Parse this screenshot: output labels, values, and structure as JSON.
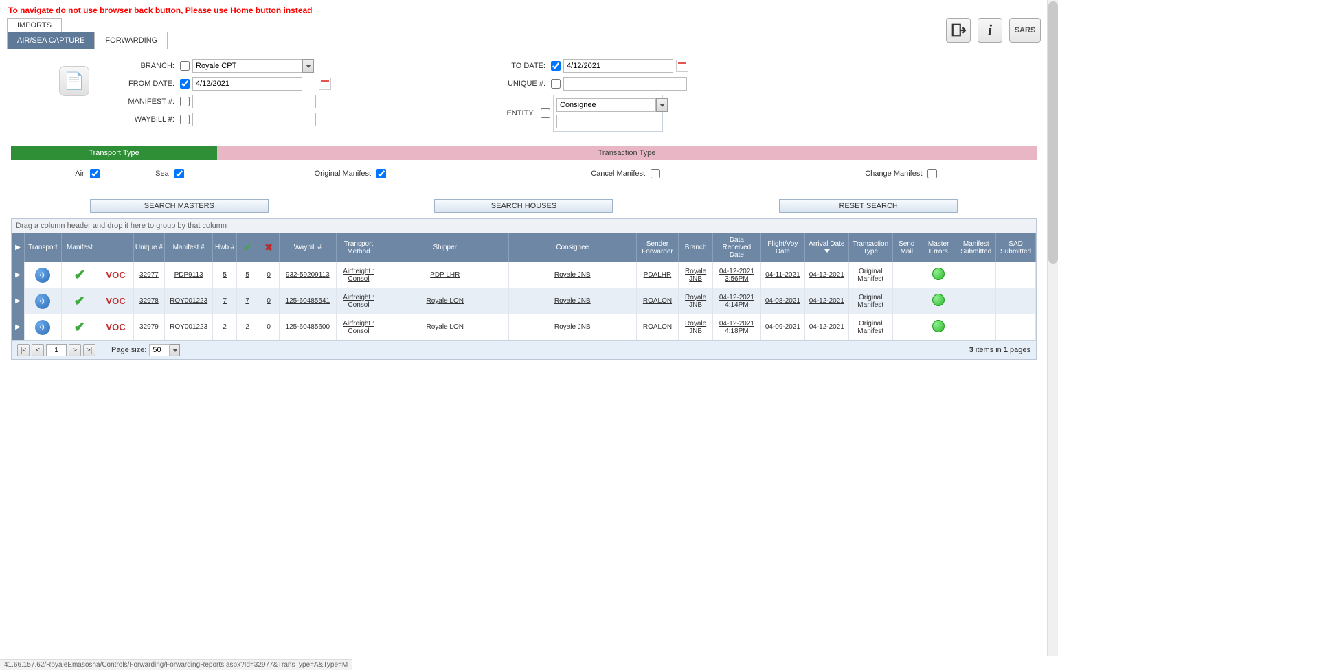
{
  "warning": "To navigate do not use browser back button, Please use Home button instead",
  "tabs": {
    "main": "IMPORTS",
    "sub1": "AIR/SEA CAPTURE",
    "sub2": "FORWARDING"
  },
  "top_icons": {
    "sars": "SARS"
  },
  "filters": {
    "branch_lbl": "BRANCH:",
    "branch_val": "Royale CPT",
    "from_lbl": "FROM DATE:",
    "from_val": "4/12/2021",
    "manifest_lbl": "MANIFEST #:",
    "manifest_val": "",
    "waybill_lbl": "WAYBILL #:",
    "waybill_val": "",
    "to_lbl": "TO DATE:",
    "to_val": "4/12/2021",
    "unique_lbl": "UNIQUE #:",
    "unique_val": "",
    "entity_lbl": "ENTITY:",
    "entity_val": "Consignee",
    "entity_text": ""
  },
  "typebars": {
    "left": "Transport Type",
    "right": "Transaction Type"
  },
  "checks": {
    "air": "Air",
    "sea": "Sea",
    "orig": "Original Manifest",
    "cancel": "Cancel Manifest",
    "change": "Change Manifest"
  },
  "buttons": {
    "masters": "SEARCH MASTERS",
    "houses": "SEARCH HOUSES",
    "reset": "RESET SEARCH"
  },
  "groupbar": "Drag a column header and drop it here to group by that column",
  "cols": [
    "",
    "Transport",
    "Manifest",
    "",
    "Unique #",
    "Manifest #",
    "Hwb #",
    "",
    "",
    "Waybill #",
    "Transport Method",
    "Shipper",
    "Consignee",
    "Sender Forwarder",
    "Branch",
    "Data Received Date",
    "Flight/Voy Date",
    "Arrival Date",
    "Transaction Type",
    "Send Mail",
    "Master Errors",
    "Manifest Submitted",
    "SAD Submitted"
  ],
  "rows": [
    {
      "voc": "VOC",
      "uniq": "32977",
      "manifest": "PDP9113",
      "hwb": "5",
      "c1": "5",
      "c2": "0",
      "waybill": "932-59209113",
      "tm": "Airfreight : Consol",
      "shipper": "PDP LHR",
      "consignee": "Royale JNB",
      "sender": "PDALHR",
      "branch": "Royale JNB",
      "recv": "04-12-2021 3:56PM",
      "flight": "04-11-2021",
      "arrival": "04-12-2021",
      "ttype": "Original Manifest"
    },
    {
      "voc": "VOC",
      "uniq": "32978",
      "manifest": "ROY001223",
      "hwb": "7",
      "c1": "7",
      "c2": "0",
      "waybill": "125-60485541",
      "tm": "Airfreight : Consol",
      "shipper": "Royale LON",
      "consignee": "Royale JNB",
      "sender": "ROALON",
      "branch": "Royale JNB",
      "recv": "04-12-2021 4:14PM",
      "flight": "04-08-2021",
      "arrival": "04-12-2021",
      "ttype": "Original Manifest"
    },
    {
      "voc": "VOC",
      "uniq": "32979",
      "manifest": "ROY001223",
      "hwb": "2",
      "c1": "2",
      "c2": "0",
      "waybill": "125-60485600",
      "tm": "Airfreight : Consol",
      "shipper": "Royale LON",
      "consignee": "Royale JNB",
      "sender": "ROALON",
      "branch": "Royale JNB",
      "recv": "04-12-2021 4:18PM",
      "flight": "04-09-2021",
      "arrival": "04-12-2021",
      "ttype": "Original Manifest"
    }
  ],
  "pager": {
    "page": "1",
    "size_lbl": "Page size:",
    "size_val": "50",
    "summary_a": "3",
    "summary_b": " items in ",
    "summary_c": "1",
    "summary_d": " pages"
  },
  "statusbar": "41.66.157.62/RoyaleEmasosha/Controls/Forwarding/ForwardingReports.aspx?Id=32977&TransType=A&Type=M"
}
